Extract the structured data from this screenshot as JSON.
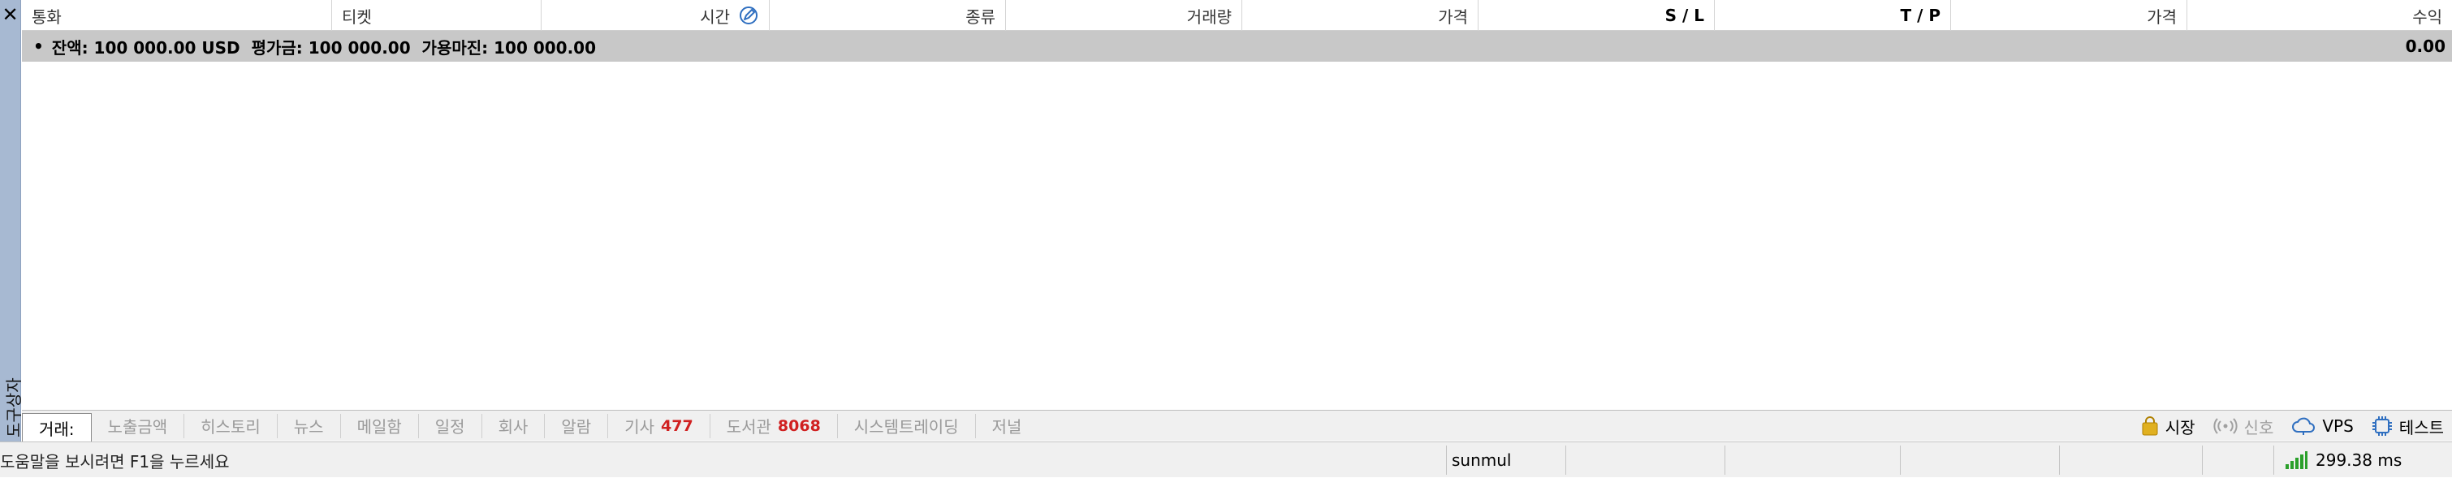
{
  "side_panel": {
    "close_glyph": "✕",
    "label": "도구상자"
  },
  "columns": [
    {
      "label": "통화",
      "align": "left"
    },
    {
      "label": "티켓",
      "align": "left"
    },
    {
      "label": "시간",
      "align": "right"
    },
    {
      "label": "종류",
      "align": "right"
    },
    {
      "label": "거래량",
      "align": "right"
    },
    {
      "label": "가격",
      "align": "right"
    },
    {
      "label": "S / L",
      "align": "right"
    },
    {
      "label": "T / P",
      "align": "right"
    },
    {
      "label": "가격",
      "align": "right"
    },
    {
      "label": "수익",
      "align": "right"
    }
  ],
  "summary": {
    "bullet": "•",
    "text": "잔액: 100 000.00 USD  평가금: 100 000.00  가용마진: 100 000.00",
    "profit": "0.00"
  },
  "tabs": [
    {
      "label": "거래:",
      "badge": "",
      "active": true
    },
    {
      "label": "노출금액",
      "badge": "",
      "active": false
    },
    {
      "label": "히스토리",
      "badge": "",
      "active": false
    },
    {
      "label": "뉴스",
      "badge": "",
      "active": false
    },
    {
      "label": "메일함",
      "badge": "",
      "active": false
    },
    {
      "label": "일정",
      "badge": "",
      "active": false
    },
    {
      "label": "회사",
      "badge": "",
      "active": false
    },
    {
      "label": "알람",
      "badge": "",
      "active": false
    },
    {
      "label": "기사",
      "badge": "477",
      "active": false
    },
    {
      "label": "도서관",
      "badge": "8068",
      "active": false
    },
    {
      "label": "시스템트레이딩",
      "badge": "",
      "active": false
    },
    {
      "label": "저널",
      "badge": "",
      "active": false
    }
  ],
  "tab_right": {
    "market": "시장",
    "signals": "신호",
    "vps": "VPS",
    "test": "테스트"
  },
  "status": {
    "help": "도움말을 보시려면 F1을 누르세요",
    "profile": "sunmul",
    "ping": "299.38 ms"
  },
  "colors": {
    "side_strip": "#a7b9d2",
    "summary_bg": "#c8c8c8",
    "badge": "#d02020",
    "signal_green": "#2aa02a",
    "accent_blue": "#2f6fc0",
    "lock_gold": "#e0b020"
  }
}
